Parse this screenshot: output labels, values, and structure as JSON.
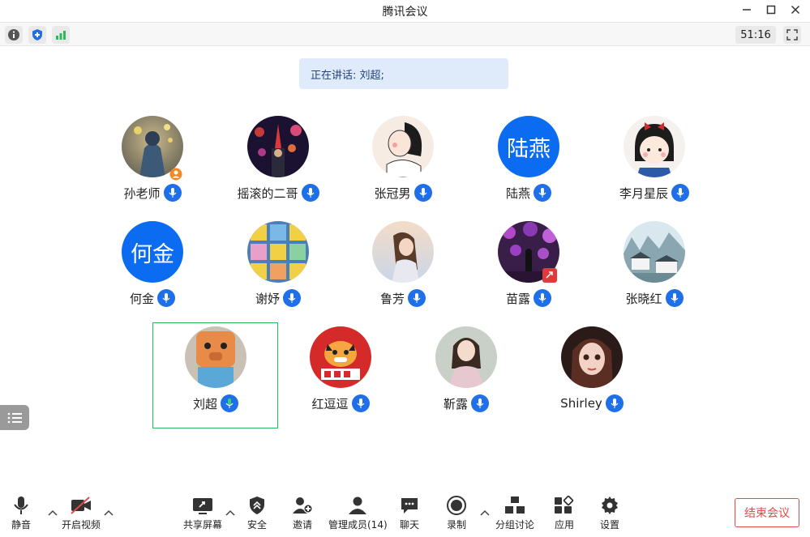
{
  "window": {
    "title": "腾讯会议"
  },
  "topbar": {
    "timer": "51:16"
  },
  "speaking": {
    "label": "正在讲话: 刘超;"
  },
  "participants": [
    {
      "name": "孙老师",
      "avatar": "photo",
      "host": true
    },
    {
      "name": "摇滚的二哥",
      "avatar": "photo"
    },
    {
      "name": "张冠男",
      "avatar": "photo"
    },
    {
      "name": "陆燕",
      "avatar": "text",
      "avatar_text": "陆燕"
    },
    {
      "name": "李月星辰",
      "avatar": "photo"
    },
    {
      "name": "何金",
      "avatar": "text",
      "avatar_text": "何金"
    },
    {
      "name": "谢妤",
      "avatar": "photo"
    },
    {
      "name": "鲁芳",
      "avatar": "photo"
    },
    {
      "name": "苗露",
      "avatar": "photo"
    },
    {
      "name": "张晓红",
      "avatar": "photo"
    },
    {
      "name": "刘超",
      "avatar": "photo",
      "speaking": true
    },
    {
      "name": "红逗逗",
      "avatar": "photo"
    },
    {
      "name": "靳露",
      "avatar": "photo"
    },
    {
      "name": "Shirley",
      "avatar": "photo"
    }
  ],
  "bottombar": {
    "mute": "静音",
    "video": "开启视频",
    "share": "共享屏幕",
    "security": "安全",
    "invite": "邀请",
    "members": "管理成员(14)",
    "chat": "聊天",
    "record": "录制",
    "breakout": "分组讨论",
    "apps": "应用",
    "settings": "设置",
    "end": "结束会议"
  },
  "colors": {
    "accent": "#1e6fe8",
    "speaking_border": "#2db85c",
    "end": "#e04a4a",
    "banner": "#dfeafb"
  }
}
